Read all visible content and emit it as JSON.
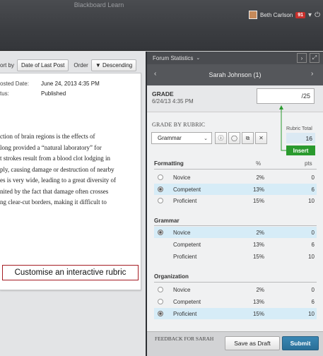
{
  "app": {
    "title": "Blackboard Learn",
    "user_name": "Beth Carlson",
    "notification_count": "91"
  },
  "sort": {
    "sort_by_label": "ort by",
    "sort_button": "Date of Last Post",
    "order_label": "Order",
    "order_button": "▼ Descending"
  },
  "post": {
    "posted_date_label": "osted Date:",
    "posted_date_value": "June 24, 2013 4:35 PM",
    "status_label": "tus:",
    "status_value": "Published",
    "body_lines": [
      "ction of brain regions is the effects of",
      "long provided a “natural laboratory” for",
      "t strokes result from a blood clot lodging in",
      "ply, causing damage or destruction of nearby",
      "es is very wide, leading to a great diversity of",
      "nited by the fact that damage often crosses",
      "ng clear-cut borders, making it difficult to"
    ]
  },
  "callout": "Customise an interactive rubric",
  "panel": {
    "forum_stats": "Forum Statistics",
    "student": "Sarah Johnson (1)",
    "grade_label": "GRADE",
    "grade_date": "6/24/13 4:35 PM",
    "grade_total": "/25",
    "rubric_heading": "GRADE BY RUBRIC",
    "rubric_selected": "Grammar",
    "rubric_total_label": "Rubric Total",
    "rubric_total": "16",
    "insert_label": "Insert",
    "pct_header": "%",
    "pts_header": "pts"
  },
  "criteria": [
    {
      "name": "Formatting",
      "levels": [
        {
          "name": "Novice",
          "pct": "2%",
          "pts": "0",
          "selected": false
        },
        {
          "name": "Competent",
          "pct": "13%",
          "pts": "6",
          "selected": true
        },
        {
          "name": "Proficient",
          "pct": "15%",
          "pts": "10",
          "selected": false
        }
      ]
    },
    {
      "name": "Grammar",
      "levels": [
        {
          "name": "Novice",
          "pct": "2%",
          "pts": "0",
          "selected": true
        },
        {
          "name": "Competent",
          "pct": "13%",
          "pts": "6",
          "selected": false
        },
        {
          "name": "Proficient",
          "pct": "15%",
          "pts": "10",
          "selected": false
        }
      ]
    },
    {
      "name": "Organization",
      "levels": [
        {
          "name": "Novice",
          "pct": "2%",
          "pts": "0",
          "selected": false
        },
        {
          "name": "Competent",
          "pct": "13%",
          "pts": "6",
          "selected": false
        },
        {
          "name": "Proficient",
          "pct": "15%",
          "pts": "10",
          "selected": true
        }
      ]
    }
  ],
  "footer": {
    "feedback_label": "FEEDBACK FOR SARAH",
    "draft_button": "Save as Draft",
    "submit_button": "Submit"
  },
  "colors": {
    "selected_row": "#d6ecf7",
    "insert_green": "#2a9a2e",
    "submit_blue": "#2f7aa6",
    "callout_border": "#a51d24"
  }
}
